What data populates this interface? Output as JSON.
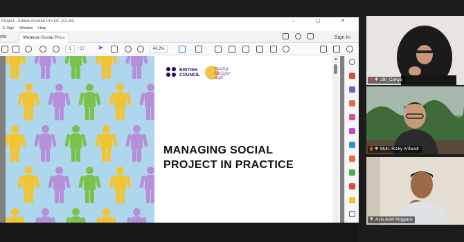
{
  "window": {
    "title": "Project - Adobe Acrobat Pro DC (32-bit)",
    "window_controls": "– ▢ ✕"
  },
  "menu": {
    "items": [
      "E-Sign",
      "Window",
      "Help"
    ]
  },
  "tabs": {
    "tools_label": "ols",
    "doc_tab_label": "Webinar-Social Pro...",
    "doc_tab_close": "×",
    "sign_in": "Sign In"
  },
  "toolbar": {
    "page_current": "1",
    "page_total": "/ 17",
    "zoom": "44.2%"
  },
  "document": {
    "logo_british_council_1": "BRITISH",
    "logo_british_council_2": "COUNCIL",
    "logo_rba_1": "ruang",
    "logo_rba_2": "belajar",
    "logo_rba_3": "aqil",
    "title_line1": "MANAGING SOCIAL",
    "title_line2": "PROJECT IN PRACTICE"
  },
  "participants": [
    {
      "name": "JBI_Cahya"
    },
    {
      "name": "Muh. Rizky Arifandi"
    },
    {
      "name": "Azis Arief Anggara"
    }
  ],
  "colors": {
    "figure_palette": [
      "#f2c431",
      "#e8453c",
      "#f08a3a",
      "#7bc24b",
      "#2aa7d8",
      "#f39ab7",
      "#b58fd8",
      "#f6e25c",
      "#f0b27a"
    ],
    "british_council_navy": "#23085a",
    "rba_yellow": "#f2c14e"
  }
}
